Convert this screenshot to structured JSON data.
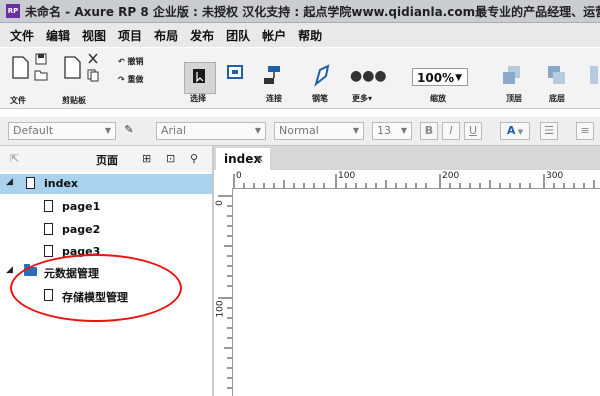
{
  "window": {
    "app_icon": "RP",
    "title": "未命名 - Axure RP 8 企业版 : 未授权 汉化支持 : 起点学院www.qidianla.com最专业的产品经理、运营"
  },
  "menu": [
    "文件",
    "编辑",
    "视图",
    "项目",
    "布局",
    "发布",
    "团队",
    "帐户",
    "帮助"
  ],
  "toolbar": {
    "undo_label": "撤销",
    "redo_label": "重做",
    "file_label": "文件",
    "clipboard_label": "剪贴板",
    "select_label": "选择",
    "connect_label": "连接",
    "pen_label": "钢笔",
    "more_label": "更多▾",
    "zoom_value": "100%",
    "zoom_label": "缩放",
    "top_label": "顶层",
    "bottom_label": "底层"
  },
  "format": {
    "style": "Default",
    "font": "Arial",
    "weight": "Normal",
    "size": "13",
    "bold": "B",
    "italic": "I",
    "underline": "U",
    "font_color": "A"
  },
  "pages_panel": {
    "title": "页面",
    "items": [
      {
        "label": "index"
      },
      {
        "label": "page1"
      },
      {
        "label": "page2"
      },
      {
        "label": "page3"
      },
      {
        "label": "元数据管理"
      },
      {
        "label": "存储模型管理"
      }
    ]
  },
  "canvas": {
    "tab_label": "index",
    "tab_close": "×",
    "ruler_h": [
      "0",
      "100",
      "200",
      "300"
    ],
    "ruler_v": [
      "0",
      "100"
    ]
  },
  "colors": {
    "selected_row": "#a8d2ee",
    "annotation": "#e11111",
    "folder": "#2a6fb5"
  }
}
